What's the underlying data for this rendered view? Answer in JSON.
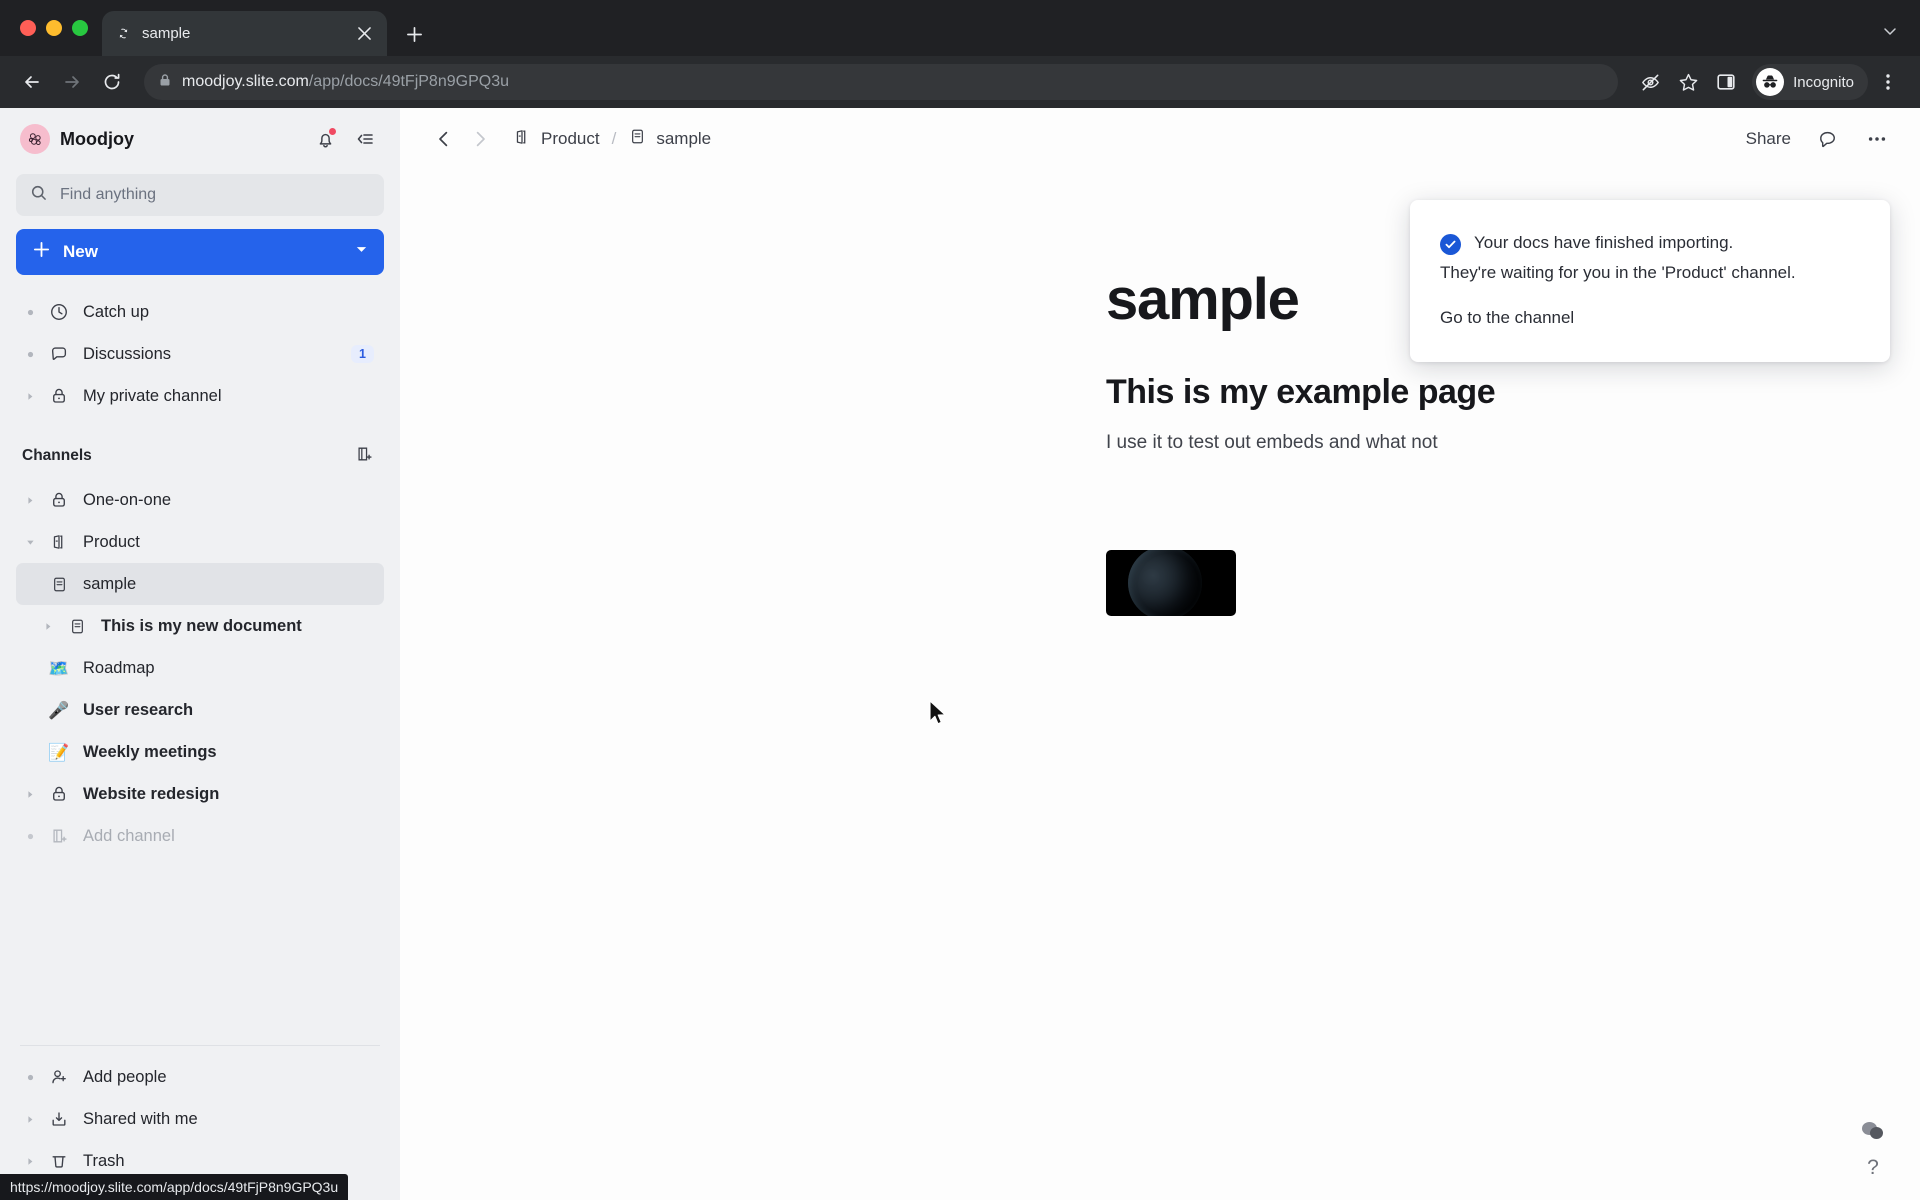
{
  "browser": {
    "tab": {
      "title": "sample",
      "favicon_icon": "slite-favicon",
      "close_icon": "close-icon"
    },
    "new_tab_icon": "plus-icon",
    "tab_list_icon": "chevron-down-icon",
    "back_icon": "arrow-back-icon",
    "forward_icon": "arrow-forward-icon",
    "reload_icon": "reload-icon",
    "lock_icon": "lock-icon",
    "url_domain": "moodjoy.slite.com",
    "url_path": "/app/docs/49tFjP8n9GPQ3u",
    "icons": {
      "eye_slash": "eye-slash-icon",
      "bookmark_star": "star-icon",
      "side_panel": "side-panel-icon",
      "incognito": "incognito-avatar-icon",
      "menu": "kebab-menu-icon"
    },
    "profile_label": "Incognito",
    "status_bar_url": "https://moodjoy.slite.com/app/docs/49tFjP8n9GPQ3u"
  },
  "sidebar": {
    "workspace_name": "Moodjoy",
    "logo_icon": "moodjoy-logo-icon",
    "notification_icon": "bell-icon",
    "collapse_icon": "collapse-sidebar-icon",
    "search": {
      "placeholder": "Find anything",
      "icon": "search-icon"
    },
    "new_button": {
      "label": "New",
      "plus_icon": "plus-icon",
      "caret_icon": "chevron-down-icon"
    },
    "nav": [
      {
        "label": "Catch up",
        "icon": "clock-icon",
        "twisty": "dot"
      },
      {
        "label": "Discussions",
        "icon": "chat-bubble-icon",
        "twisty": "dot",
        "badge": "1"
      },
      {
        "label": "My private channel",
        "icon": "lock-icon",
        "twisty": "collapsed"
      }
    ],
    "channels_section": {
      "title": "Channels",
      "add_icon": "add-channel-icon"
    },
    "channels": [
      {
        "label": "One-on-one",
        "icon": "lock-icon",
        "twisty": "collapsed",
        "indent": 0
      },
      {
        "label": "Product",
        "icon": "channel-icon",
        "twisty": "expanded",
        "indent": 0
      },
      {
        "label": "sample",
        "icon": "doc-icon",
        "twisty": "none",
        "indent": 1,
        "selected": true
      },
      {
        "label": "This is my new document",
        "icon": "doc-icon",
        "twisty": "collapsed",
        "indent": 1,
        "bold": true
      },
      {
        "label": "Roadmap",
        "icon": "emoji",
        "emoji": "🗺️",
        "twisty": "none",
        "indent": 1,
        "bold": false
      },
      {
        "label": "User research",
        "icon": "emoji",
        "emoji": "🎤",
        "twisty": "none",
        "indent": 1,
        "bold": true
      },
      {
        "label": "Weekly meetings",
        "icon": "emoji",
        "emoji": "📝",
        "twisty": "none",
        "indent": 1,
        "bold": true
      },
      {
        "label": "Website redesign",
        "icon": "lock-icon",
        "twisty": "collapsed",
        "indent": 0,
        "bold": true
      },
      {
        "label": "Add channel",
        "icon": "add-channel-icon",
        "twisty": "dot",
        "indent": 0,
        "muted": true
      }
    ],
    "bottom_nav": [
      {
        "label": "Add people",
        "icon": "add-person-icon",
        "twisty": "dot"
      },
      {
        "label": "Shared with me",
        "icon": "inbox-download-icon",
        "twisty": "collapsed"
      },
      {
        "label": "Trash",
        "icon": "trash-icon",
        "twisty": "collapsed"
      }
    ]
  },
  "doc_header": {
    "back_icon": "chevron-left-icon",
    "forward_icon": "chevron-right-icon",
    "breadcrumb": {
      "channel": "Product",
      "channel_icon": "channel-icon",
      "separator": "/",
      "doc": "sample",
      "doc_icon": "doc-icon"
    },
    "share_label": "Share",
    "comment_icon": "comment-icon",
    "more_icon": "more-horizontal-icon"
  },
  "document": {
    "title": "sample",
    "heading": "This is my example page",
    "paragraph": "I use it to test out embeds and what not",
    "embed_alt": "dark planet image embed"
  },
  "toast": {
    "check_icon": "check-circle-icon",
    "title": "Your docs have finished importing.",
    "subtitle": "They're waiting for you in the 'Product' channel.",
    "link": "Go to the channel"
  },
  "help_widget": {
    "blob_icon": "chat-blob-icon",
    "question_label": "?"
  },
  "colors": {
    "accent_blue": "#2563eb",
    "toast_check_blue": "#1a57d6",
    "badge_blue": "#2c5ce0",
    "notification_red": "#f04a62",
    "sidebar_bg": "#f0f1f3",
    "logo_pink": "#f6bdcd"
  }
}
